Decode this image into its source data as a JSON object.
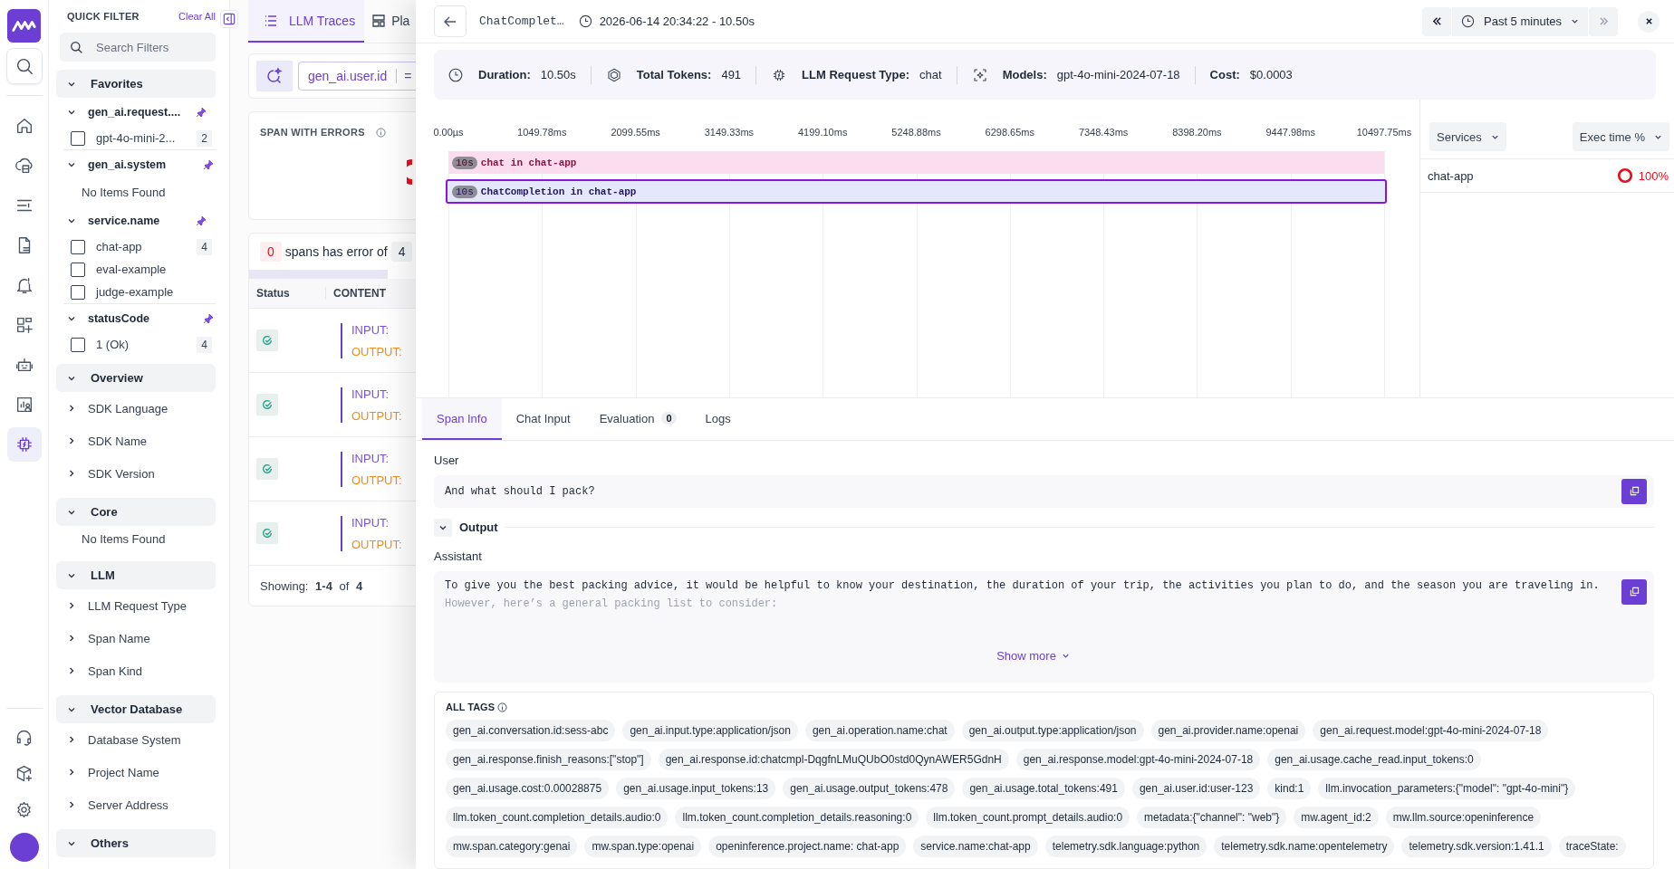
{
  "rail": {
    "top": [
      {
        "selected": false
      },
      {
        "selected": false
      },
      {
        "selected": false
      },
      {
        "selected": false
      },
      {
        "selected": false
      },
      {
        "selected": false
      },
      {
        "selected": false
      },
      {
        "selected": false
      },
      {
        "selected": false
      },
      {
        "selected": true
      }
    ],
    "bottom": [
      {
        "selected": false
      },
      {
        "selected": false
      },
      {
        "selected": false
      }
    ]
  },
  "quick_filter": {
    "title": "QUICK FILTER",
    "clear_label": "Clear All",
    "search": {
      "placeholder": "Search Filters"
    },
    "groups": [
      {
        "label": "Favorites",
        "expanded": true,
        "children": [
          {
            "label": "gen_ai.request....",
            "expanded": true,
            "pinned": true,
            "options": [
              {
                "label": "gpt-4o-mini-2...",
                "count": "2",
                "checked": false
              }
            ]
          },
          {
            "label": "gen_ai.system",
            "expanded": true,
            "pinned": true,
            "empty_text": "No Items Found"
          },
          {
            "label": "service.name",
            "expanded": true,
            "pinned": true,
            "options": [
              {
                "label": "chat-app",
                "count": "4",
                "checked": false
              },
              {
                "label": "eval-example",
                "checked": false
              },
              {
                "label": "judge-example",
                "checked": false
              }
            ]
          },
          {
            "label": "statusCode",
            "expanded": true,
            "pinned": true,
            "options": [
              {
                "label": "1 (Ok)",
                "count": "4",
                "checked": false
              }
            ]
          }
        ]
      },
      {
        "label": "Overview",
        "expanded": true,
        "children": [
          {
            "label": "SDK Language",
            "expanded": false
          },
          {
            "label": "SDK Name",
            "expanded": false
          },
          {
            "label": "SDK Version",
            "expanded": false
          }
        ]
      },
      {
        "label": "Core",
        "expanded": true,
        "empty_text": "No Items Found"
      },
      {
        "label": "LLM",
        "expanded": true,
        "children": [
          {
            "label": "LLM Request Type",
            "expanded": false
          },
          {
            "label": "Span Name",
            "expanded": false
          },
          {
            "label": "Span Kind",
            "expanded": false
          }
        ]
      },
      {
        "label": "Vector Database",
        "expanded": true,
        "children": [
          {
            "label": "Database System",
            "expanded": false
          },
          {
            "label": "Project Name",
            "expanded": false
          },
          {
            "label": "Server Address",
            "expanded": false
          }
        ]
      },
      {
        "label": "Others",
        "expanded": true
      }
    ]
  },
  "background_page": {
    "tabs": [
      {
        "label": "LLM Traces",
        "selected": true
      },
      {
        "label": "Pla",
        "selected": false
      }
    ],
    "query": {
      "field": "gen_ai.user.id",
      "operator": "="
    },
    "errors_card": {
      "title": "SPAN WITH ERRORS"
    },
    "error_summary": {
      "error_count": "0",
      "text": "spans has error of",
      "total": "4"
    },
    "table": {
      "columns": [
        "Status",
        "CONTENT"
      ],
      "rows": [
        {
          "kind": "ok",
          "input_label": "INPUT:",
          "output_label": "OUTPUT:"
        },
        {
          "kind": "ok",
          "input_label": "INPUT:",
          "output_label": "OUTPUT:"
        },
        {
          "kind": "ok",
          "input_label": "INPUT:",
          "output_label": "OUTPUT:"
        },
        {
          "kind": "ok",
          "input_label": "INPUT:",
          "output_label": "OUTPUT:"
        }
      ]
    },
    "footer": "Showing: **1-4** of **4**"
  },
  "drawer": {
    "header": {
      "title": "ChatComplet…",
      "timestamp": "2026-06-14 20:34:22 - 10.50s",
      "time_range": "Past 5 minutes",
      "next_disabled": true
    },
    "summary": [
      {
        "label": "Duration:",
        "value": "10.50s"
      },
      {
        "label": "Total Tokens:",
        "value": "491"
      },
      {
        "label": "LLM Request Type:",
        "value": "chat"
      },
      {
        "label": "Models:",
        "value": "gpt-4o-mini-2024-07-18"
      },
      {
        "label": "Cost:",
        "value": "$0.0003"
      }
    ],
    "timeline": {
      "ticks": [
        "0.00µs",
        "1049.78ms",
        "2099.55ms",
        "3149.33ms",
        "4199.10ms",
        "5248.88ms",
        "6298.65ms",
        "7348.43ms",
        "8398.20ms",
        "9447.98ms",
        "10497.75ms"
      ],
      "spans": [
        {
          "badge": "10s",
          "label": "chat in chat-app",
          "color": "#fcdcef",
          "selected": false
        },
        {
          "badge": "10s",
          "label": "ChatCompletion in chat-app",
          "color": "#e5e7fd",
          "selected": true
        }
      ]
    },
    "services": {
      "group_by": "Services",
      "sort_by": "Exec time %",
      "rows": [
        {
          "name": "chat-app",
          "share": "100%"
        }
      ]
    },
    "tabs": [
      {
        "label": "Span Info",
        "selected": true
      },
      {
        "label": "Chat Input",
        "selected": false
      },
      {
        "label": "Evaluation",
        "selected": false,
        "count": "0"
      },
      {
        "label": "Logs",
        "selected": false
      }
    ],
    "span_info": {
      "input": {
        "role": "User",
        "text": "And what should I pack?"
      },
      "output": {
        "title": "Output",
        "expanded": true,
        "role": "Assistant",
        "collapsed": true,
        "show_more": "Show more",
        "lines": [
          "To give you the best packing advice, it would be helpful to know your destination, the duration of your trip, the activities you plan to do, and the season you are traveling in.",
          "However, here’s a general packing list to consider:"
        ]
      },
      "tags": {
        "title": "ALL TAGS",
        "items": [
          "gen_ai.conversation.id:sess-abc",
          "gen_ai.input.type:application/json",
          "gen_ai.operation.name:chat",
          "gen_ai.output.type:application/json",
          "gen_ai.provider.name:openai",
          "gen_ai.request.model:gpt-4o-mini-2024-07-18",
          "gen_ai.response.finish_reasons:[\"stop\"]",
          "gen_ai.response.id:chatcmpl-DqgfnLMuQUbO0std0QynAWER5GdnH",
          "gen_ai.response.model:gpt-4o-mini-2024-07-18",
          "gen_ai.usage.cache_read.input_tokens:0",
          "gen_ai.usage.cost:0.00028875",
          "gen_ai.usage.input_tokens:13",
          "gen_ai.usage.output_tokens:478",
          "gen_ai.usage.total_tokens:491",
          "gen_ai.user.id:user-123",
          "kind:1",
          "llm.invocation_parameters:{\"model\": \"gpt-4o-mini\"}",
          "llm.token_count.completion_details.audio:0",
          "llm.token_count.completion_details.reasoning:0",
          "llm.token_count.prompt_details.audio:0",
          "metadata:{\"channel\": \"web\"}",
          "mw.agent_id:2",
          "mw.llm.source:openinference",
          "mw.span.category:genai",
          "mw.span.type:openai",
          "openinference.project.name: chat-app",
          "service.name:chat-app",
          "telemetry.sdk.language:python",
          "telemetry.sdk.name:opentelemetry",
          "telemetry.sdk.version:1.41.1",
          "traceState:"
        ]
      }
    }
  }
}
